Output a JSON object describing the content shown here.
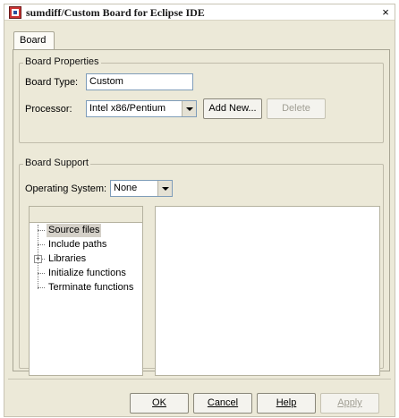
{
  "window": {
    "title": "sumdiff/Custom Board for Eclipse IDE",
    "close_glyph": "×",
    "app_icon": "board-app-icon"
  },
  "tabs": [
    {
      "label": "Board",
      "active": true
    }
  ],
  "board_properties": {
    "legend": "Board Properties",
    "board_type_label": "Board Type:",
    "board_type_value": "Custom",
    "processor_label": "Processor:",
    "processor_value": "Intel x86/Pentium",
    "add_new_label": "Add New...",
    "delete_label": "Delete"
  },
  "board_support": {
    "legend": "Board Support",
    "os_label": "Operating System:",
    "os_value": "None",
    "tree_items": [
      {
        "label": "Source files",
        "selected": true,
        "expandable": false
      },
      {
        "label": "Include paths",
        "selected": false,
        "expandable": false
      },
      {
        "label": "Libraries",
        "selected": false,
        "expandable": true
      },
      {
        "label": "Initialize functions",
        "selected": false,
        "expandable": false
      },
      {
        "label": "Terminate functions",
        "selected": false,
        "expandable": false
      }
    ]
  },
  "footer": {
    "ok_label": "OK",
    "cancel_label": "Cancel",
    "help_label": "Help",
    "apply_label": "Apply"
  },
  "colors": {
    "dialog_bg": "#ece9d8",
    "field_border": "#7f9db9",
    "disabled_text": "#a19f94",
    "selection_bg": "#d4d0c8"
  }
}
